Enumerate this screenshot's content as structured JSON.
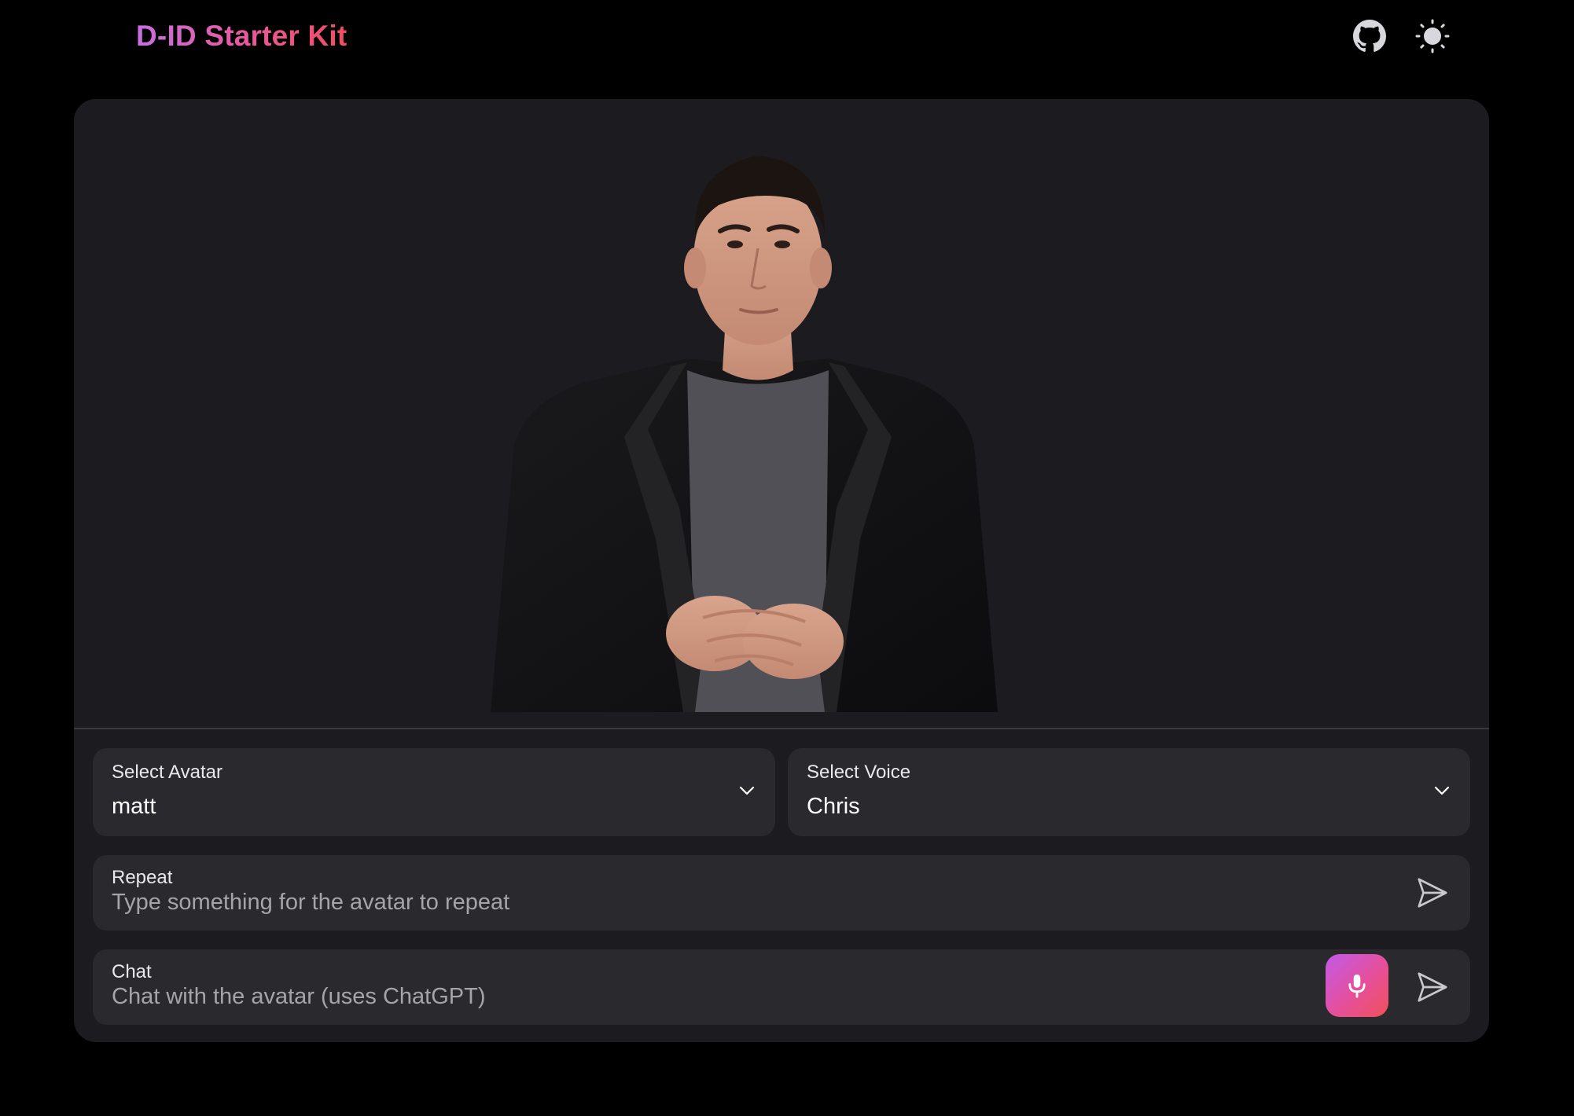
{
  "header": {
    "brand": "D-ID Starter Kit",
    "github_icon": "github-icon",
    "theme_icon": "sun-icon"
  },
  "avatar_select": {
    "label": "Select Avatar",
    "value": "matt"
  },
  "voice_select": {
    "label": "Select Voice",
    "value": "Chris"
  },
  "repeat": {
    "label": "Repeat",
    "placeholder": "Type something for the avatar to repeat"
  },
  "chat": {
    "label": "Chat",
    "placeholder": "Chat with the avatar (uses ChatGPT)"
  },
  "colors": {
    "background": "#000000",
    "card": "#1c1b20",
    "field": "#2a2a2e",
    "brand_gradient_start": "#c86fe0",
    "brand_gradient_end": "#ef4e5e"
  }
}
